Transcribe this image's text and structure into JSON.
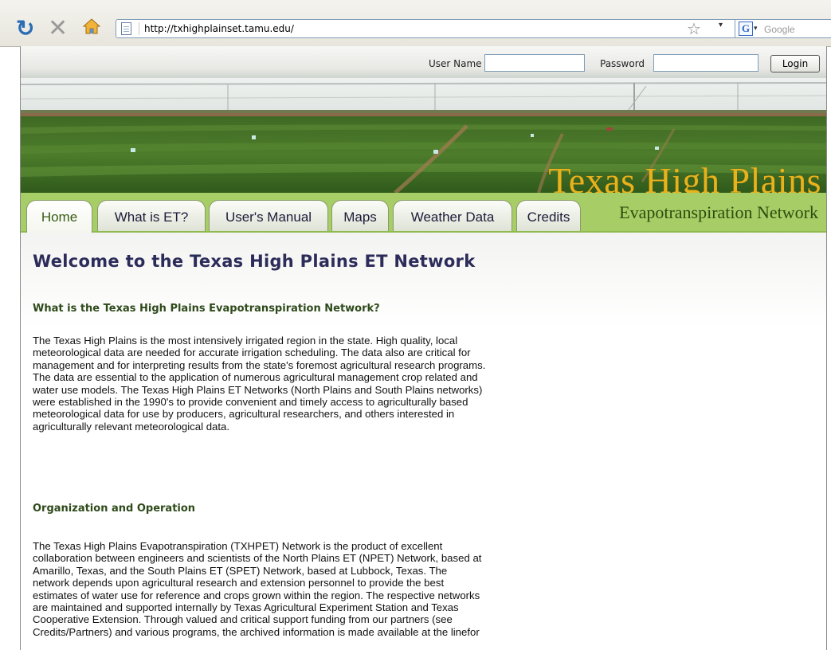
{
  "browser": {
    "url": "http://txhighplainset.tamu.edu/",
    "search_placeholder": "Google",
    "icons": [
      "reload-icon",
      "stop-icon",
      "home-icon",
      "page-icon",
      "bookmark-star-icon",
      "google-icon"
    ]
  },
  "login": {
    "username_label": "User Name",
    "username_value": "",
    "password_label": "Password",
    "password_value": "",
    "button": "Login"
  },
  "banner": {
    "title": "Texas High Plains",
    "subtitle": "Evapotranspiration Network"
  },
  "nav": {
    "tabs": [
      {
        "label": "Home",
        "active": true
      },
      {
        "label": "What is ET?",
        "active": false
      },
      {
        "label": "User's Manual",
        "active": false
      },
      {
        "label": "Maps",
        "active": false
      },
      {
        "label": "Weather Data",
        "active": false
      },
      {
        "label": "Credits",
        "active": false
      }
    ]
  },
  "content": {
    "title": "Welcome to the Texas High Plains ET Network",
    "section1": {
      "heading": "What is the Texas High Plains Evapotranspiration Network?",
      "lines": [
        "The Texas High Plains is the most intensively irrigated region in the state. High quality, local",
        "meteorological data are needed for accurate irrigation scheduling. The data also are critical for",
        "management and for interpreting results from the state's foremost agricultural research programs.",
        "The data are essential to the application of numerous agricultural management crop related and",
        "water use models. The Texas High Plains ET Networks (North Plains and South Plains networks)",
        "were established in the 1990's to provide convenient and timely access to agriculturally based",
        "meteorological data for use by producers, agricultural researchers, and others interested in",
        "agriculturally relevant meteorological data."
      ]
    },
    "section2": {
      "heading": "Organization and Operation",
      "lines": [
        "The Texas High Plains Evapotranspiration (TXHPET) Network is the product of excellent",
        "collaboration between engineers and scientists of the North Plains ET (NPET) Network, based at",
        "Amarillo, Texas, and the South Plains ET (SPET) Network, based at Lubbock, Texas. The",
        "network depends upon agricultural research and extension personnel to provide the best",
        "estimates of water use for reference and crops grown within the region. The respective networks",
        "are maintained and supported internally by Texas Agricultural Experiment Station and Texas",
        "Cooperative Extension. Through valued and critical support funding from our partners (see",
        "Credits/Partners) and various programs, the archived information is made available at the linefor"
      ]
    }
  }
}
